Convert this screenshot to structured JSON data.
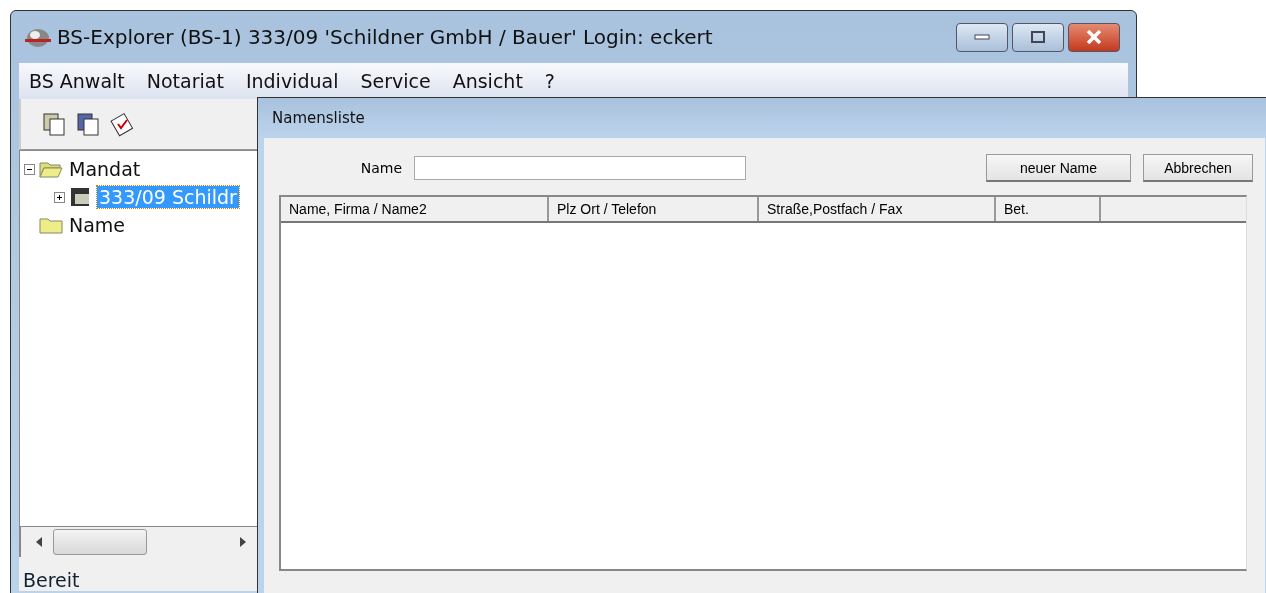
{
  "main_window": {
    "title": "BS-Explorer (BS-1) 333/09 'Schildner GmbH / Bauer' Login: eckert",
    "menu": [
      "BS Anwalt",
      "Notariat",
      "Individual",
      "Service",
      "Ansicht",
      "?"
    ],
    "tree": [
      {
        "label": "Mandat",
        "kind": "folder",
        "expanded": true,
        "selected": false,
        "children": [
          {
            "label": "333/09 Schildr",
            "kind": "file",
            "expanded": false,
            "selected": true
          }
        ]
      },
      {
        "label": "Name",
        "kind": "folder",
        "selected": false
      }
    ],
    "status_bar": "Bereit"
  },
  "dialog": {
    "title": "Namensliste",
    "name_label": "Name",
    "buttons": [
      "neuer Name",
      "Abbrechen"
    ],
    "table": {
      "columns": [
        "Name, Firma / Name2",
        "Plz Ort / Telefon",
        "Straße,Postfach / Fax",
        "Bet."
      ]
    }
  }
}
